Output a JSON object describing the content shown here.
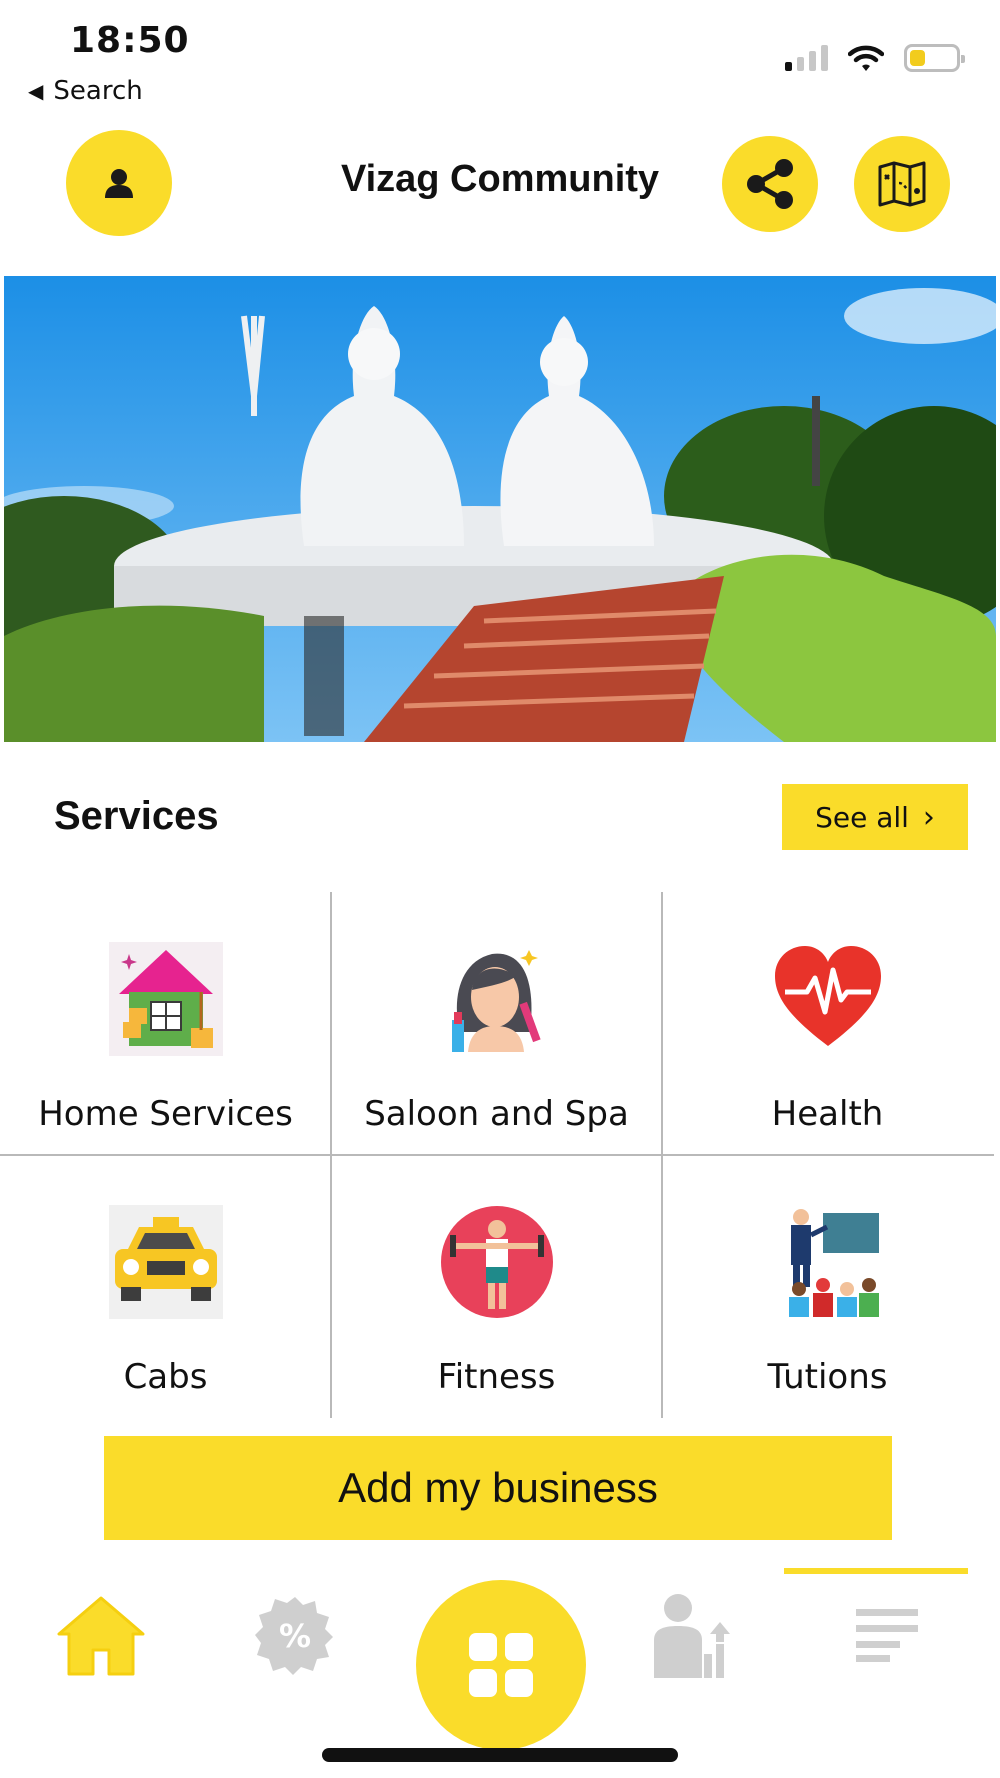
{
  "status_bar": {
    "time": "18:50",
    "back_label": "Search"
  },
  "header": {
    "title": "Vizag Community"
  },
  "services": {
    "title": "Services",
    "see_all_label": "See all",
    "items": [
      {
        "label": "Home Services",
        "icon": "home-services-icon"
      },
      {
        "label": "Saloon and Spa",
        "icon": "saloon-spa-icon"
      },
      {
        "label": "Health",
        "icon": "health-heart-icon"
      },
      {
        "label": "Cabs",
        "icon": "cab-icon"
      },
      {
        "label": "Fitness",
        "icon": "fitness-icon"
      },
      {
        "label": "Tutions",
        "icon": "tutions-icon"
      }
    ]
  },
  "add_business_label": "Add my business",
  "bottom_nav": {
    "active": "home",
    "items": [
      "home-icon",
      "discount-icon",
      "grid-icon",
      "business-growth-icon",
      "menu-icon"
    ]
  },
  "colors": {
    "accent": "#fadc2a",
    "inactive_icon": "#cfcfcf"
  }
}
